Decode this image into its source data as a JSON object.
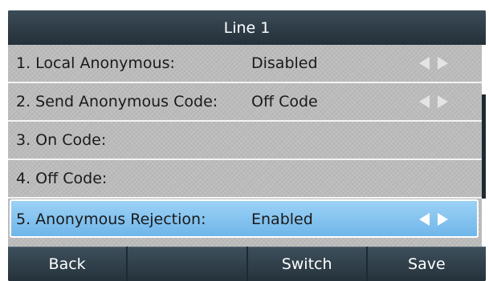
{
  "header": {
    "title": "Line 1"
  },
  "rows": [
    {
      "label": "1. Local Anonymous:",
      "value": "Disabled",
      "has_arrows": true
    },
    {
      "label": "2. Send Anonymous Code:",
      "value": "Off Code",
      "has_arrows": true
    },
    {
      "label": "3. On Code:",
      "value": "",
      "has_arrows": false
    },
    {
      "label": "4. Off Code:",
      "value": "",
      "has_arrows": false
    },
    {
      "label": "5. Anonymous Rejection:",
      "value": "Enabled",
      "has_arrows": true,
      "selected": true
    }
  ],
  "softkeys": [
    {
      "label": "Back"
    },
    {
      "label": ""
    },
    {
      "label": "Switch"
    },
    {
      "label": "Save"
    }
  ],
  "colors": {
    "title_bar": "#243039",
    "list_background": "#bcbcbc",
    "selected_row": "#6fb6ea",
    "arrow": "#e4e4e4"
  },
  "icons": {
    "left": "left-triangle-icon",
    "right": "right-triangle-icon"
  }
}
